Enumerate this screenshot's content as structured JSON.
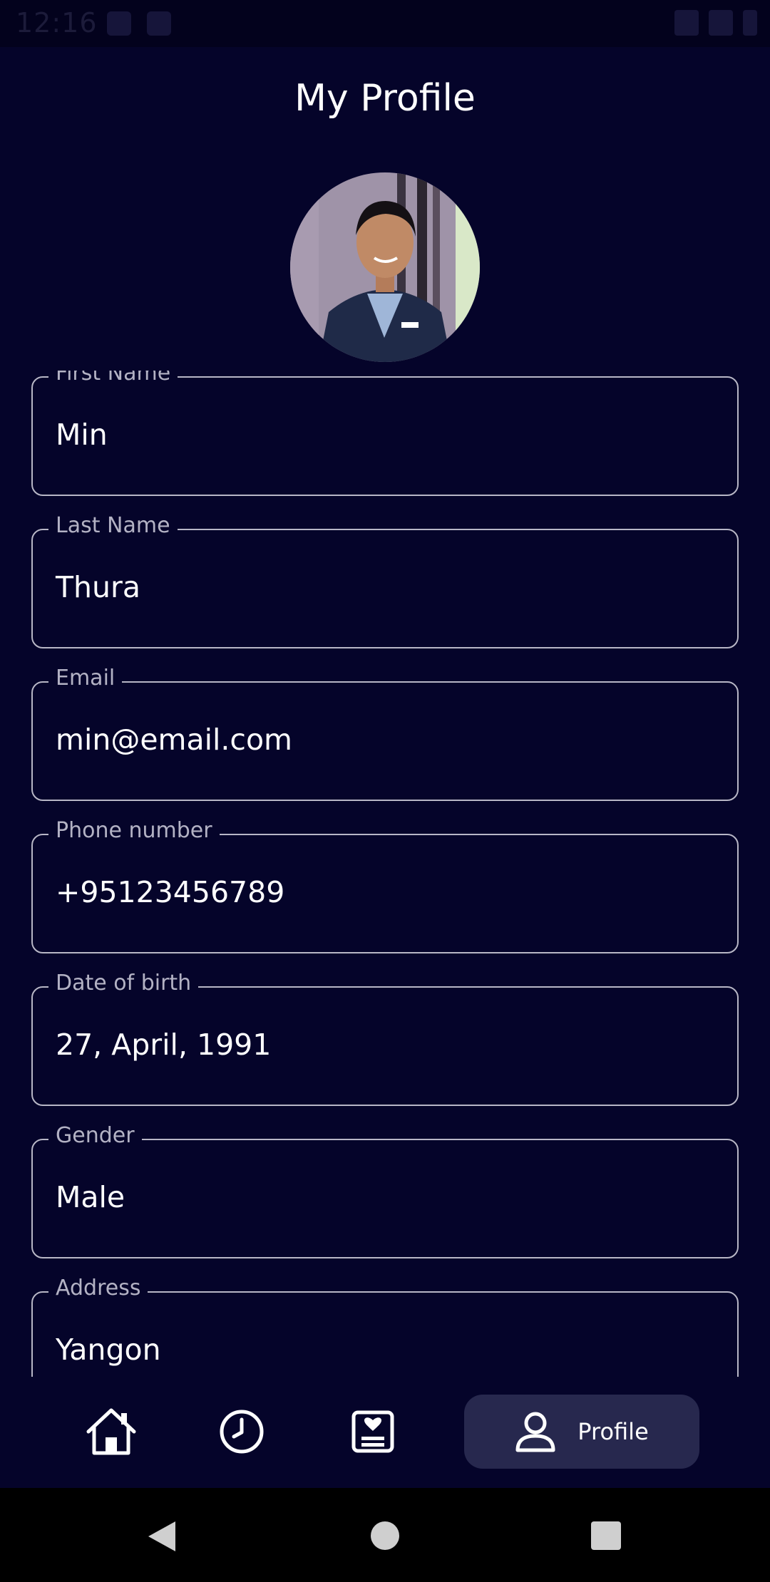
{
  "status_bar": {
    "time": "12:16"
  },
  "header": {
    "title": "My Profile"
  },
  "profile": {
    "fields": [
      {
        "label": "First Name",
        "value": "Min"
      },
      {
        "label": "Last Name",
        "value": "Thura"
      },
      {
        "label": "Email",
        "value": "min@email.com"
      },
      {
        "label": "Phone number",
        "value": "+95123456789"
      },
      {
        "label": "Date of birth",
        "value": "27, April, 1991"
      },
      {
        "label": "Gender",
        "value": "Male"
      },
      {
        "label": "Address",
        "value": "Yangon"
      }
    ]
  },
  "bottom_nav": {
    "items": [
      {
        "icon": "home-icon"
      },
      {
        "icon": "clock-icon"
      },
      {
        "icon": "card-heart-icon"
      },
      {
        "icon": "person-icon",
        "label": "Profile",
        "active": true
      }
    ]
  },
  "colors": {
    "background": "#05042a",
    "field_border": "#b8b7c6",
    "label": "#b3b2c4",
    "active_tab": "#27284e"
  }
}
